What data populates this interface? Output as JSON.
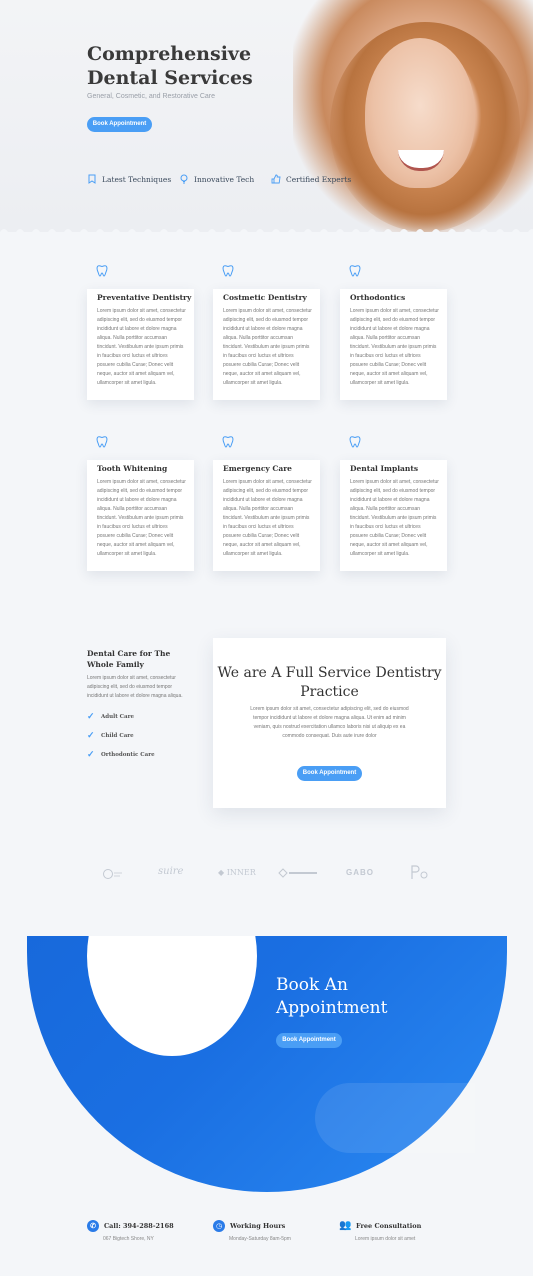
{
  "hero": {
    "title": "Comprehensive Dental Services",
    "subtitle": "General, Cosmetic, and Restorative Care",
    "button": "Book Appointment",
    "features": [
      {
        "label": "Latest Techniques",
        "icon": "bookmark-icon"
      },
      {
        "label": "Innovative Tech",
        "icon": "lightbulb-icon"
      },
      {
        "label": "Certified Experts",
        "icon": "thumbs-up-icon"
      }
    ]
  },
  "services": [
    {
      "title": "Preventative Dentistry",
      "icon": "tooth-icon",
      "body": "Lorem ipsum dolor sit amet, consectetur adipiscing elit, sed do eiusmod tempor incididunt ut labore et dolore magna aliqua. Nulla porttitor accumsan tincidunt. Vestibulum ante ipsum primis in faucibus orci luctus et ultrices posuere cubilia Curae; Donec velit neque, auctor sit amet aliquam vel, ullamcorper sit amet ligula."
    },
    {
      "title": "Costmetic Dentistry",
      "icon": "sparkle-tooth-icon",
      "body": "Lorem ipsum dolor sit amet, consectetur adipiscing elit, sed do eiusmod tempor incididunt ut labore et dolore magna aliqua. Nulla porttitor accumsan tincidunt. Vestibulum ante ipsum primis in faucibus orci luctus et ultrices posuere cubilia Curae; Donec velit neque, auctor sit amet aliquam vel, ullamcorper sit amet ligula."
    },
    {
      "title": "Orthodontics",
      "icon": "braces-icon",
      "body": "Lorem ipsum dolor sit amet, consectetur adipiscing elit, sed do eiusmod tempor incididunt ut labore et dolore magna aliqua. Nulla porttitor accumsan tincidunt. Vestibulum ante ipsum primis in faucibus orci luctus et ultrices posuere cubilia Curae; Donec velit neque, auctor sit amet aliquam vel, ullamcorper sit amet ligula."
    },
    {
      "title": "Tooth Whitening",
      "icon": "whitening-icon",
      "body": "Lorem ipsum dolor sit amet, consectetur adipiscing elit, sed do eiusmod tempor incididunt ut labore et dolore magna aliqua. Nulla porttitor accumsan tincidunt. Vestibulum ante ipsum primis in faucibus orci luctus et ultrices posuere cubilia Curae; Donec velit neque, auctor sit amet aliquam vel, ullamcorper sit amet ligula."
    },
    {
      "title": "Emergency Care",
      "icon": "broken-tooth-icon",
      "body": "Lorem ipsum dolor sit amet, consectetur adipiscing elit, sed do eiusmod tempor incididunt ut labore et dolore magna aliqua. Nulla porttitor accumsan tincidunt. Vestibulum ante ipsum primis in faucibus orci luctus et ultrices posuere cubilia Curae; Donec velit neque, auctor sit amet aliquam vel, ullamcorper sit amet ligula."
    },
    {
      "title": "Dental Implants",
      "icon": "implant-icon",
      "body": "Lorem ipsum dolor sit amet, consectetur adipiscing elit, sed do eiusmod tempor incididunt ut labore et dolore magna aliqua. Nulla porttitor accumsan tincidunt. Vestibulum ante ipsum primis in faucibus orci luctus et ultrices posuere cubilia Curae; Donec velit neque, auctor sit amet aliquam vel, ullamcorper sit amet ligula."
    }
  ],
  "family": {
    "title": "Dental Care for The Whole Family",
    "body": "Lorem ipsum dolor sit amet, consectetur adipiscing elit, sed do eiusmod tempor incididunt ut labore et dolore magna aliqua.",
    "items": [
      "Adult Care",
      "Child Care",
      "Orthodontic Care"
    ]
  },
  "full_service": {
    "title": "We are A Full Service Dentistry Practice",
    "body": "Lorem ipsum dolor sit amet, consectetur adipiscing elit, sed do eiusmod tempor incididunt ut labore et dolore magna aliqua. Ut enim ad minim veniam, quis nostrud exercitation ullamco laboris nisi ut aliquip ex ea commodo consequat. Duis aute irure dolor",
    "button": "Book Appointment"
  },
  "logos": [
    "logo-1",
    "suire",
    "INNER",
    "logo-4",
    "GABO",
    "logo-6"
  ],
  "book": {
    "title": "Book An Appointment",
    "button": "Book Appointment"
  },
  "footer": [
    {
      "title": "Call: 394-288-2168",
      "sub": "067 Bigtech Shore, NY",
      "icon": "phone-icon"
    },
    {
      "title": "Working Hours",
      "sub": "Monday-Saturday 8am-5pm",
      "icon": "clock-icon"
    },
    {
      "title": "Free Consultation",
      "sub": "Lorem ipsum dolor sit amet",
      "icon": "people-icon"
    }
  ],
  "colors": {
    "accent": "#4a9ef5",
    "brand_blue": "#1a6fe2"
  }
}
